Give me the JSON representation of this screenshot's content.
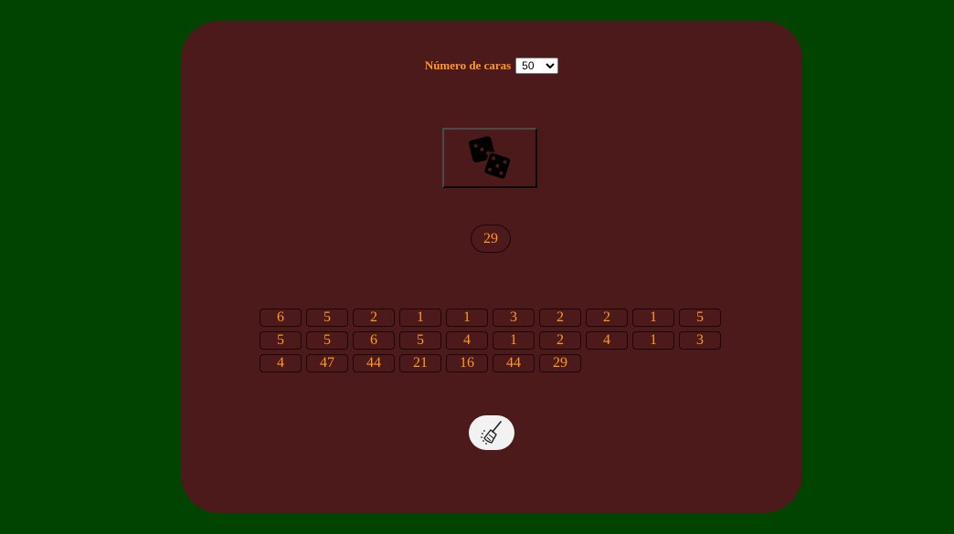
{
  "controls": {
    "faces_label": "Número de caras",
    "faces_selected": "50"
  },
  "roll_button": {
    "icon": "dice-icon"
  },
  "result": {
    "value": "29"
  },
  "history": [
    "6",
    "5",
    "2",
    "1",
    "1",
    "3",
    "2",
    "2",
    "1",
    "5",
    "5",
    "5",
    "6",
    "5",
    "4",
    "1",
    "2",
    "4",
    "1",
    "3",
    "4",
    "47",
    "44",
    "21",
    "16",
    "44",
    "29"
  ],
  "clear_button": {
    "icon": "broom-icon"
  },
  "colors": {
    "background": "#004400",
    "panel": "#4d1a1c",
    "accent_text": "#ff9a1a",
    "clear_button_bg": "#f2f2f2"
  }
}
